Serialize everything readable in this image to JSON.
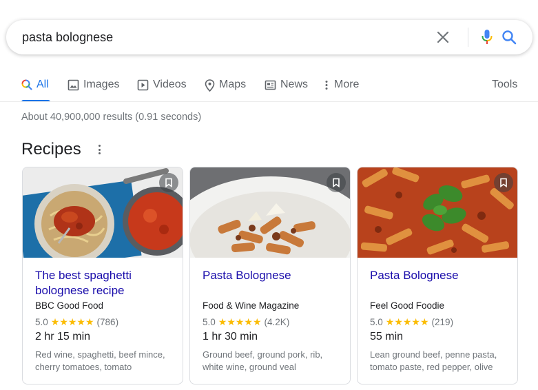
{
  "search": {
    "query": "pasta bolognese"
  },
  "tabs": [
    {
      "label": "All",
      "icon": "search-icon",
      "active": true
    },
    {
      "label": "Images",
      "icon": "image-icon"
    },
    {
      "label": "Videos",
      "icon": "play-icon"
    },
    {
      "label": "Maps",
      "icon": "map-pin-icon"
    },
    {
      "label": "News",
      "icon": "newspaper-icon"
    },
    {
      "label": "More",
      "icon": "more-vert-icon"
    }
  ],
  "tools_label": "Tools",
  "result_stats": "About 40,900,000 results (0.91 seconds)",
  "recipes": {
    "title": "Recipes",
    "cards": [
      {
        "title": "The best spaghetti bolognese recipe",
        "source": "BBC Good Food",
        "rating": "5.0",
        "stars": "★★★★★",
        "reviews": "(786)",
        "time": "2 hr 15 min",
        "ingredients": "Red wine, spaghetti, beef mince, cherry tomatoes, tomato"
      },
      {
        "title": "Pasta Bolognese",
        "source": "Food & Wine Magazine",
        "rating": "5.0",
        "stars": "★★★★★",
        "reviews": "(4.2K)",
        "time": "1 hr 30 min",
        "ingredients": "Ground beef, ground pork, rib, white wine, ground veal"
      },
      {
        "title": "Pasta Bolognese",
        "source": "Feel Good Foodie",
        "rating": "5.0",
        "stars": "★★★★★",
        "reviews": "(219)",
        "time": "55 min",
        "ingredients": "Lean ground beef, penne pasta, tomato paste, red pepper, olive"
      }
    ]
  },
  "colors": {
    "accent": "#1a73e8",
    "link": "#1a0dab",
    "star": "#fbbc04",
    "muted": "#70757a"
  }
}
